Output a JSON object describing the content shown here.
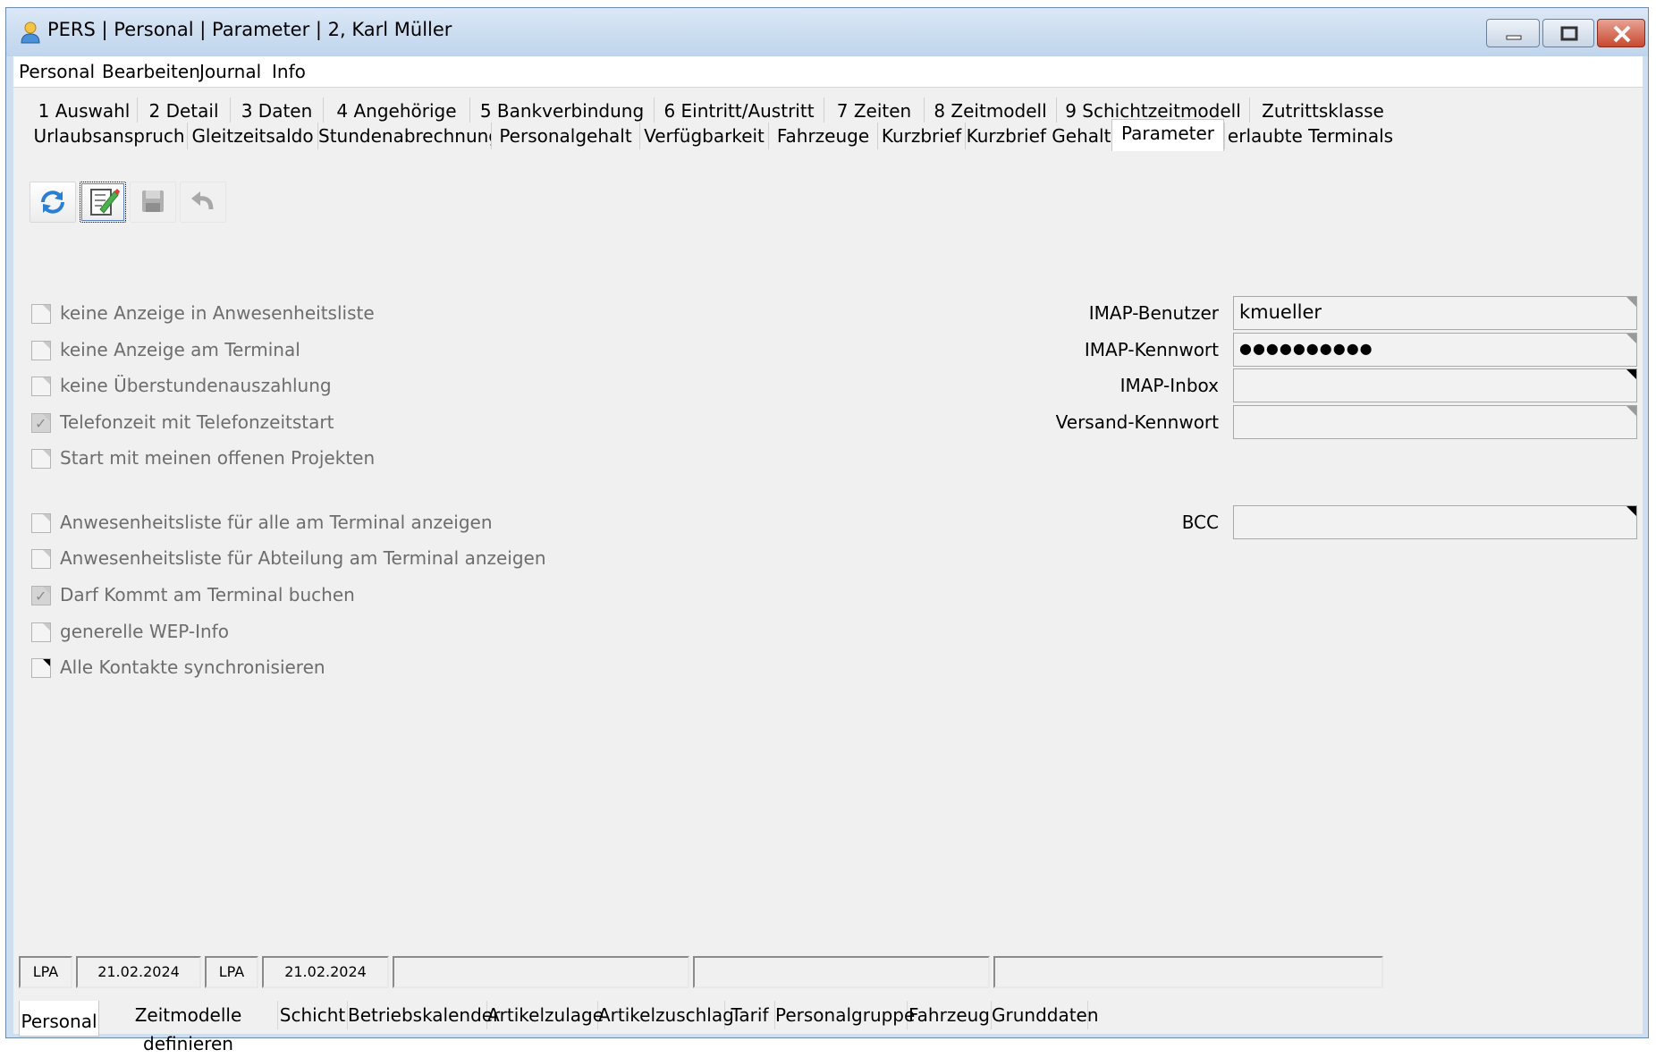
{
  "window": {
    "title": "PERS | Personal | Parameter | 2, Karl Müller"
  },
  "menu": [
    "Personal",
    "Bearbeiten",
    "Journal",
    "Info"
  ],
  "tabs_row1": [
    "1 Auswahl",
    "2 Detail",
    "3 Daten",
    "4 Angehörige",
    "5 Bankverbindung",
    "6 Eintritt/Austritt",
    "7 Zeiten",
    "8 Zeitmodell",
    "9 Schichtzeitmodell",
    "Zutrittsklasse"
  ],
  "tabs_row2": [
    "Urlaubsanspruch",
    "Gleitzeitsaldo",
    "Stundenabrechnung",
    "Personalgehalt",
    "Verfügbarkeit",
    "Fahrzeuge",
    "Kurzbrief",
    "Kurzbrief Gehalt",
    "Parameter",
    "erlaubte Terminals"
  ],
  "active_tab": "Parameter",
  "toolbar": {
    "refresh": "refresh-icon",
    "edit": "edit-icon",
    "save": "save-icon",
    "undo": "undo-icon"
  },
  "checkboxes": [
    {
      "label": "keine Anzeige in Anwesenheitsliste",
      "checked": false
    },
    {
      "label": "keine Anzeige am Terminal",
      "checked": false
    },
    {
      "label": "keine Überstundenauszahlung",
      "checked": false
    },
    {
      "label": "Telefonzeit mit Telefonzeitstart",
      "checked": true
    },
    {
      "label": "Start mit meinen offenen Projekten",
      "checked": false
    },
    {
      "label": "Anwesenheitsliste für alle am Terminal anzeigen",
      "checked": false
    },
    {
      "label": "Anwesenheitsliste für Abteilung am Terminal anzeigen",
      "checked": false
    },
    {
      "label": "Darf Kommt am Terminal buchen",
      "checked": true
    },
    {
      "label": "generelle WEP-Info",
      "checked": false
    },
    {
      "label": "Alle Kontakte synchronisieren",
      "checked": false
    }
  ],
  "fields": {
    "imap_user": {
      "label": "IMAP-Benutzer",
      "value": "kmueller"
    },
    "imap_pass": {
      "label": "IMAP-Kennwort",
      "value": "●●●●●●●●●●"
    },
    "imap_inbox": {
      "label": "IMAP-Inbox",
      "value": ""
    },
    "send_pass": {
      "label": "Versand-Kennwort",
      "value": ""
    },
    "bcc": {
      "label": "BCC",
      "value": ""
    }
  },
  "status": [
    "LPA",
    "21.02.2024",
    "LPA",
    "21.02.2024",
    "",
    "",
    ""
  ],
  "bottom_tabs": [
    "Personal",
    "Zeitmodelle definieren",
    "Schicht",
    "Betriebskalender",
    "Artikelzulage",
    "Artikelzuschlag",
    "Tarif",
    "Personalgruppe",
    "Fahrzeug",
    "Grunddaten"
  ],
  "colors": {
    "accent": "#5a84c4",
    "close": "#c9482f"
  }
}
